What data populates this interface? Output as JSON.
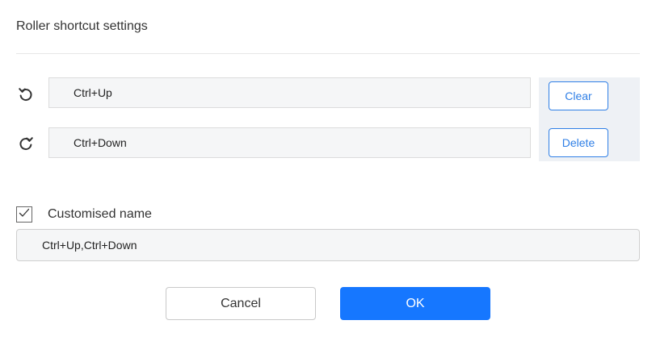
{
  "dialog": {
    "title": "Roller shortcut settings"
  },
  "shortcuts": [
    {
      "icon": "rotate-counterclockwise-icon",
      "value": "Ctrl+Up"
    },
    {
      "icon": "rotate-clockwise-icon",
      "value": "Ctrl+Down"
    }
  ],
  "actions": {
    "clear_label": "Clear",
    "delete_label": "Delete"
  },
  "custom_name": {
    "checked": true,
    "label": "Customised name",
    "value": "Ctrl+Up,Ctrl+Down"
  },
  "footer": {
    "cancel_label": "Cancel",
    "ok_label": "OK"
  },
  "colors": {
    "accent": "#1677ff",
    "field_background": "#f5f6f7",
    "panel_background": "#eef1f5"
  }
}
